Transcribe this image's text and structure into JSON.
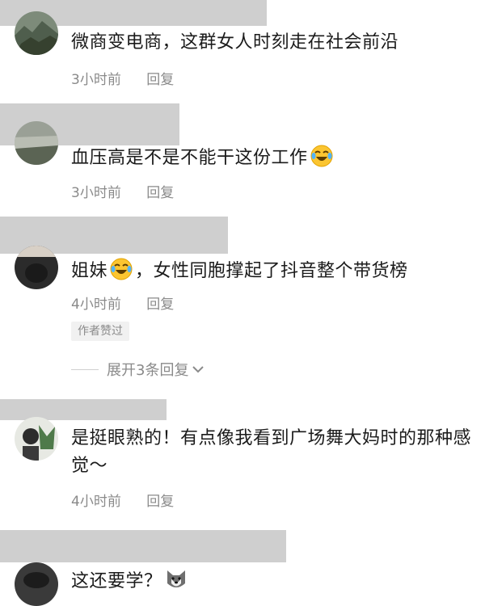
{
  "comments": [
    {
      "text": "微商变电商，这群女人时刻走在社会前沿",
      "time": "3小时前",
      "reply_label": "回复"
    },
    {
      "text": "血压高是不是不能干这份工作",
      "emoji": "laugh-cry-emoji",
      "time": "3小时前",
      "reply_label": "回复"
    },
    {
      "text_before": "姐妹",
      "emoji": "laugh-cry-emoji",
      "text_after": "，女性同胞撑起了抖音整个带货榜",
      "time": "4小时前",
      "reply_label": "回复",
      "badge": "作者赞过",
      "expand_label": "展开3条回复"
    },
    {
      "text": "是挺眼熟的！有点像我看到广场舞大妈时的那种感觉～",
      "time": "4小时前",
      "reply_label": "回复"
    },
    {
      "text": "这还要学？",
      "emoji": "husky-dog-emoji"
    }
  ]
}
